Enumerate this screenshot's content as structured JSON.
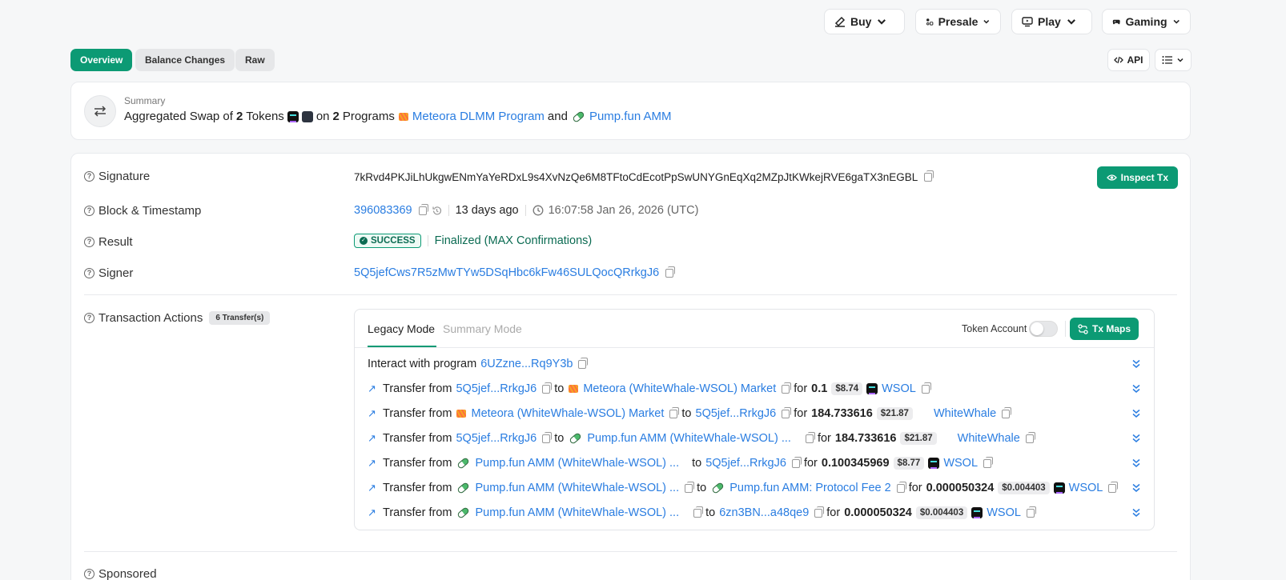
{
  "nav": {
    "buy": "Buy",
    "presale": "Presale",
    "play": "Play",
    "gaming": "Gaming"
  },
  "tabs": {
    "overview": "Overview",
    "balance_changes": "Balance Changes",
    "raw": "Raw"
  },
  "tools": {
    "api": "API"
  },
  "summary": {
    "label": "Summary",
    "prefix": "Aggregated Swap of",
    "token_count": "2",
    "tokens_word": "Tokens",
    "on_word": "on",
    "program_count": "2",
    "programs_word": "Programs",
    "program1": "Meteora DLMM Program",
    "and_word": "and",
    "program2": "Pump.fun AMM"
  },
  "details": {
    "signature_label": "Signature",
    "signature": "7kRvd4PKJiLhUkgwENmYaYeRDxL9s4XvNzQe6M8TFtoCdEcotPpSwUNYGnEqXq2MZpJtKWkejRVE6gaTX3nEGBL",
    "inspect": "Inspect Tx",
    "block_label": "Block & Timestamp",
    "block": "396083369",
    "ago": "13 days ago",
    "timestamp": "16:07:58 Jan 26, 2026 (UTC)",
    "result_label": "Result",
    "result": "SUCCESS",
    "finalized": "Finalized (MAX Confirmations)",
    "signer_label": "Signer",
    "signer": "5Q5jefCws7R5zMwTYw5DSqHbc6kFw46SULQocQRrkgJ6",
    "actions_label": "Transaction Actions",
    "actions_count": "6 Transfer(s)",
    "sponsored_label": "Sponsored"
  },
  "panel": {
    "legacy": "Legacy Mode",
    "summary": "Summary Mode",
    "token_account": "Token Account",
    "txmaps": "Tx Maps",
    "interact_text": "Interact with program",
    "interact_program": "6UZzne...Rq9Y3b"
  },
  "words": {
    "transfer_from": "Transfer from",
    "to": "to",
    "for": "for"
  },
  "transfers": [
    {
      "from": "5Q5jef...RrkgJ6",
      "to": "Meteora (WhiteWhale-WSOL) Market",
      "amount": "0.1",
      "usd": "$8.74",
      "token": "WSOL"
    },
    {
      "from": "Meteora (WhiteWhale-WSOL) Market",
      "to": "5Q5jef...RrkgJ6",
      "amount": "184.733616",
      "usd": "$21.87",
      "token": "WhiteWhale"
    },
    {
      "from": "5Q5jef...RrkgJ6",
      "to": "Pump.fun AMM (WhiteWhale-WSOL) ...",
      "amount": "184.733616",
      "usd": "$21.87",
      "token": "WhiteWhale"
    },
    {
      "from": "Pump.fun AMM (WhiteWhale-WSOL) ...",
      "to": "5Q5jef...RrkgJ6",
      "amount": "0.100345969",
      "usd": "$8.77",
      "token": "WSOL"
    },
    {
      "from": "Pump.fun AMM (WhiteWhale-WSOL) ...",
      "to": "Pump.fun AMM: Protocol Fee 2",
      "amount": "0.000050324",
      "usd": "$0.004403",
      "token": "WSOL"
    },
    {
      "from": "Pump.fun AMM (WhiteWhale-WSOL) ...",
      "to": "6zn3BN...a48qe9",
      "amount": "0.000050324",
      "usd": "$0.004403",
      "token": "WSOL"
    }
  ],
  "colors": {
    "accent": "#0c9a74",
    "link": "#2a7de1"
  }
}
